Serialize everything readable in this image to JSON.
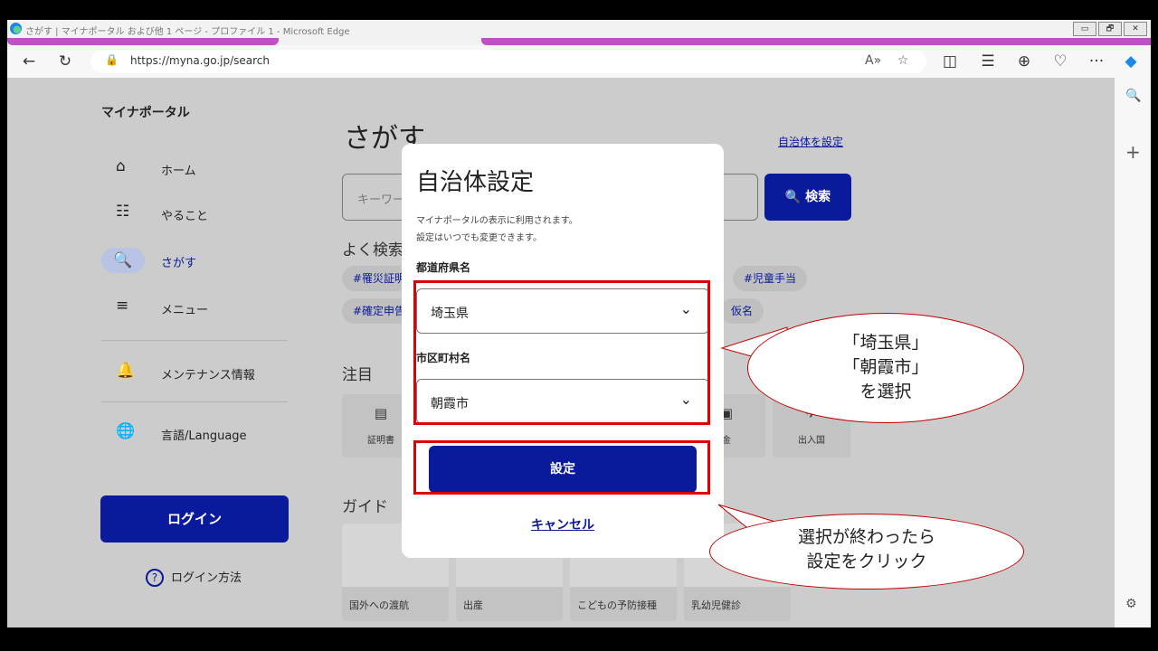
{
  "window": {
    "title": "さがす | マイナポータル および他 1 ページ - プロファイル 1 - Microsoft Edge",
    "controls": [
      "▭",
      "🗗",
      "✕"
    ]
  },
  "browser": {
    "back_icon": "←",
    "reload_icon": "↻",
    "lock_icon": "🔒",
    "url": "https://myna.go.jp/search",
    "read_aloud_icon": "A»",
    "favorite_icon": "☆",
    "split_icon": "◫",
    "favorites_icon": "☰",
    "collections_icon": "⊕",
    "performance_icon": "♡",
    "more_icon": "···",
    "copilot_icon": "◆",
    "side_search_icon": "🔍",
    "side_add_icon": "+",
    "side_settings_icon": "⚙"
  },
  "sidebar": {
    "brand": "マイナポータル",
    "items": [
      {
        "icon": "⌂",
        "label": "ホーム"
      },
      {
        "icon": "☷",
        "label": "やること"
      },
      {
        "icon": "🔍",
        "label": "さがす"
      },
      {
        "icon": "≡",
        "label": "メニュー"
      },
      {
        "icon": "🔔",
        "label": "メンテナンス情報"
      },
      {
        "icon": "🌐",
        "label": "言語/Language"
      }
    ],
    "login_label": "ログイン",
    "login_help_icon": "?",
    "login_help_label": "ログイン方法"
  },
  "main": {
    "title": "さがす",
    "set_municipality_link": "自治体を設定",
    "search_placeholder": "キーワー",
    "search_button": "🔍 検索",
    "popular_heading": "よく検索",
    "tags": [
      "#罹災証明",
      "#児童手当",
      "#確定申告",
      "仮名"
    ],
    "featured_heading": "注目",
    "categories": [
      {
        "icon": "▤",
        "label": "証明書"
      },
      {
        "icon": "▣",
        "label": "金"
      },
      {
        "icon": "✈",
        "label": "出入国"
      }
    ],
    "guide_heading": "ガイド",
    "guides": [
      "国外への渡航",
      "出産",
      "こどもの予防接種",
      "乳幼児健診"
    ]
  },
  "modal": {
    "title": "自治体設定",
    "desc_line1": "マイナポータルの表示に利用されます。",
    "desc_line2": "設定はいつでも変更できます。",
    "prefecture_label": "都道府県名",
    "prefecture_value": "埼玉県",
    "city_label": "市区町村名",
    "city_value": "朝霞市",
    "chevron": "⌄",
    "ok_button": "設定",
    "cancel_link": "キャンセル"
  },
  "annotations": {
    "bubble1_line1": "「埼玉県」",
    "bubble1_line2": "「朝霞市」",
    "bubble1_line3": "を選択",
    "bubble2_line1": "選択が終わったら",
    "bubble2_line2": "設定をクリック",
    "highlight_color": "#e00000",
    "accent_color": "#0a1a9c"
  }
}
